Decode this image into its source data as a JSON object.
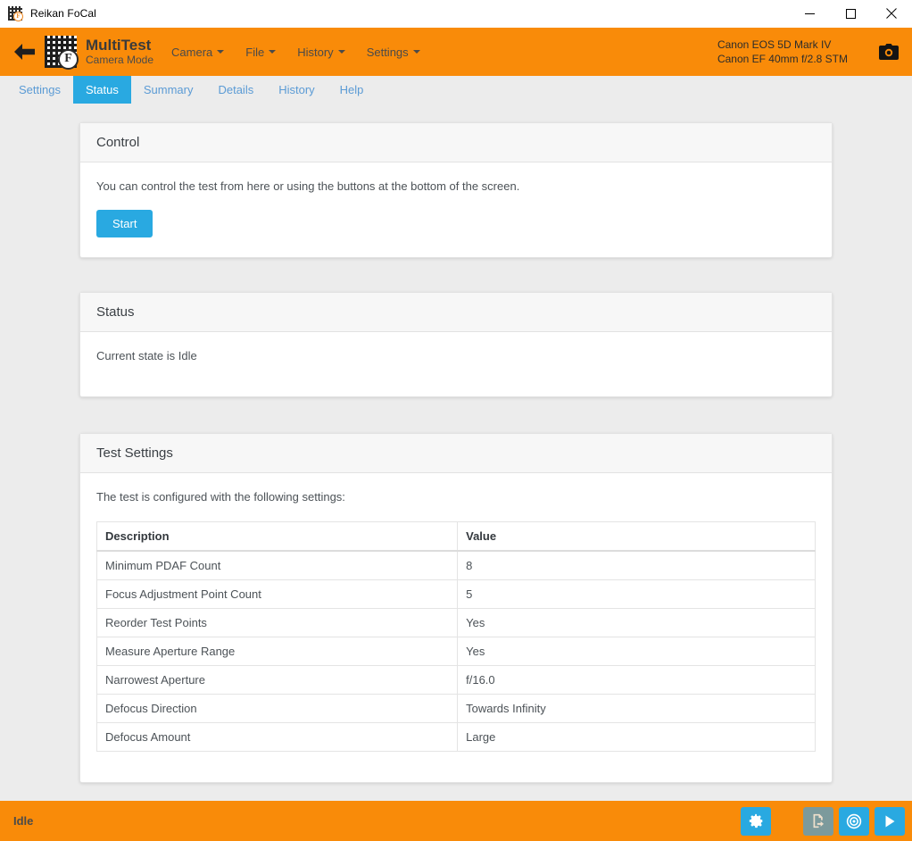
{
  "window": {
    "title": "Reikan FoCal",
    "app_icon": "qr-logo-icon",
    "minimize_label": "Minimize",
    "maximize_label": "Maximize",
    "close_label": "Close"
  },
  "header": {
    "back_label": "Back",
    "logo_letter": "F",
    "title": "MultiTest",
    "subtitle": "Camera Mode",
    "menu": [
      {
        "label": "Camera"
      },
      {
        "label": "File"
      },
      {
        "label": "History"
      },
      {
        "label": "Settings"
      }
    ],
    "camera_body": "Canon EOS 5D Mark IV",
    "camera_lens": "Canon EF 40mm f/2.8 STM",
    "camera_icon": "camera-icon",
    "background_color": "#f98b09"
  },
  "tabs": [
    {
      "label": "Settings",
      "active": false
    },
    {
      "label": "Status",
      "active": true
    },
    {
      "label": "Summary",
      "active": false
    },
    {
      "label": "Details",
      "active": false
    },
    {
      "label": "History",
      "active": false
    },
    {
      "label": "Help",
      "active": false
    }
  ],
  "tab_active_color": "#29a9e1",
  "control_panel": {
    "title": "Control",
    "description": "You can control the test from here or using the buttons at the bottom of the screen.",
    "start_button": "Start"
  },
  "status_panel": {
    "title": "Status",
    "message": "Current state is Idle"
  },
  "test_settings_panel": {
    "title": "Test Settings",
    "description": "The test is configured with the following settings:",
    "columns": [
      "Description",
      "Value"
    ],
    "rows": [
      {
        "description": "Minimum PDAF Count",
        "value": "8"
      },
      {
        "description": "Focus Adjustment Point Count",
        "value": "5"
      },
      {
        "description": "Reorder Test Points",
        "value": "Yes"
      },
      {
        "description": "Measure Aperture Range",
        "value": "Yes"
      },
      {
        "description": "Narrowest Aperture",
        "value": "f/16.0"
      },
      {
        "description": "Defocus Direction",
        "value": "Towards Infinity"
      },
      {
        "description": "Defocus Amount",
        "value": "Large"
      }
    ]
  },
  "statusbar": {
    "status": "Idle",
    "buttons": [
      {
        "name": "settings-gear-button",
        "icon": "gear-icon",
        "enabled": true
      },
      {
        "name": "export-report-button",
        "icon": "file-export-icon",
        "enabled": false
      },
      {
        "name": "target-focus-button",
        "icon": "target-icon",
        "enabled": true
      },
      {
        "name": "run-play-button",
        "icon": "play-icon",
        "enabled": true
      }
    ]
  }
}
